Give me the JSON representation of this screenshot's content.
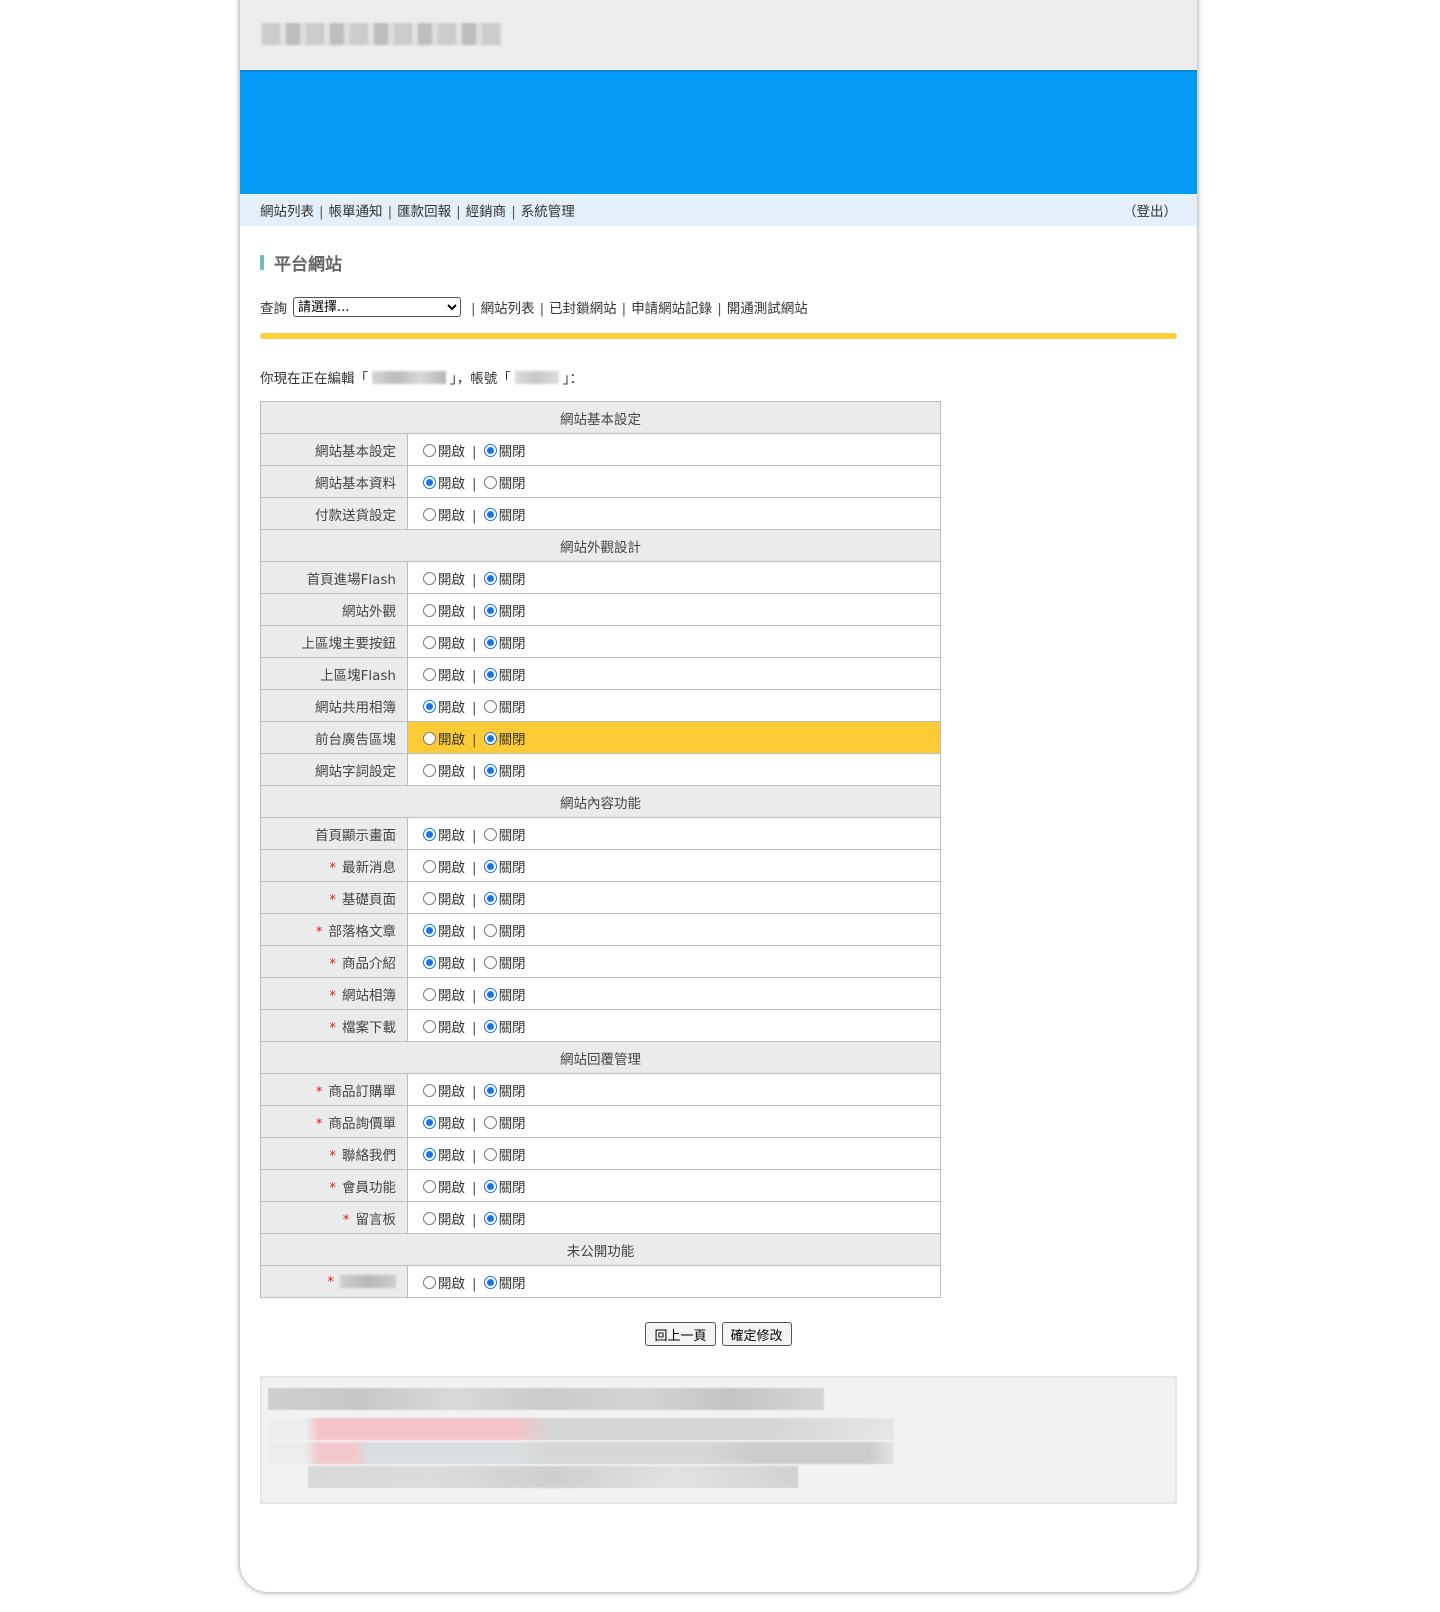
{
  "nav": {
    "items": [
      "網站列表",
      "帳單通知",
      "匯款回報",
      "經銷商",
      "系統管理"
    ],
    "logout": "（登出）"
  },
  "section_title": "平台網站",
  "query": {
    "label": "查詢",
    "select_value": "請選擇...",
    "links": [
      "網站列表",
      "已封鎖網站",
      "申請網站記錄",
      "開通測試網站"
    ]
  },
  "edit_line": {
    "prefix": "你現在正在編輯「",
    "middle": "」，帳號「",
    "suffix": "」："
  },
  "option_labels": {
    "on": "開啟",
    "off": "關閉",
    "sep": "|"
  },
  "groups": [
    {
      "title": "網站基本設定",
      "rows": [
        {
          "label": "網站基本設定",
          "required": false,
          "value": "off"
        },
        {
          "label": "網站基本資料",
          "required": false,
          "value": "on"
        },
        {
          "label": "付款送貨設定",
          "required": false,
          "value": "off"
        }
      ]
    },
    {
      "title": "網站外觀設計",
      "rows": [
        {
          "label": "首頁進場Flash",
          "required": false,
          "value": "off"
        },
        {
          "label": "網站外觀",
          "required": false,
          "value": "off"
        },
        {
          "label": "上區塊主要按鈕",
          "required": false,
          "value": "off"
        },
        {
          "label": "上區塊Flash",
          "required": false,
          "value": "off"
        },
        {
          "label": "網站共用相簿",
          "required": false,
          "value": "on"
        },
        {
          "label": "前台廣告區塊",
          "required": false,
          "value": "off",
          "highlight": true
        },
        {
          "label": "網站字詞設定",
          "required": false,
          "value": "off"
        }
      ]
    },
    {
      "title": "網站內容功能",
      "rows": [
        {
          "label": "首頁顯示畫面",
          "required": false,
          "value": "on"
        },
        {
          "label": "最新消息",
          "required": true,
          "value": "off"
        },
        {
          "label": "基礎頁面",
          "required": true,
          "value": "off"
        },
        {
          "label": "部落格文章",
          "required": true,
          "value": "on"
        },
        {
          "label": "商品介紹",
          "required": true,
          "value": "on"
        },
        {
          "label": "網站相簿",
          "required": true,
          "value": "off"
        },
        {
          "label": "檔案下載",
          "required": true,
          "value": "off"
        }
      ]
    },
    {
      "title": "網站回覆管理",
      "rows": [
        {
          "label": "商品訂購單",
          "required": true,
          "value": "off"
        },
        {
          "label": "商品詢價單",
          "required": true,
          "value": "on"
        },
        {
          "label": "聯絡我們",
          "required": true,
          "value": "on"
        },
        {
          "label": "會員功能",
          "required": true,
          "value": "off"
        },
        {
          "label": "留言板",
          "required": true,
          "value": "off"
        }
      ]
    },
    {
      "title": "未公開功能",
      "rows": [
        {
          "label": "",
          "required": true,
          "value": "off",
          "obscured": true
        }
      ]
    }
  ],
  "buttons": {
    "back": "回上一頁",
    "confirm": "確定修改"
  },
  "colors": {
    "banner": "#039bf5",
    "nav_bg": "#e3eff9",
    "accent_line": "#fdcf3f",
    "highlight_row": "#fdcb35",
    "required_star": "#e02020"
  }
}
